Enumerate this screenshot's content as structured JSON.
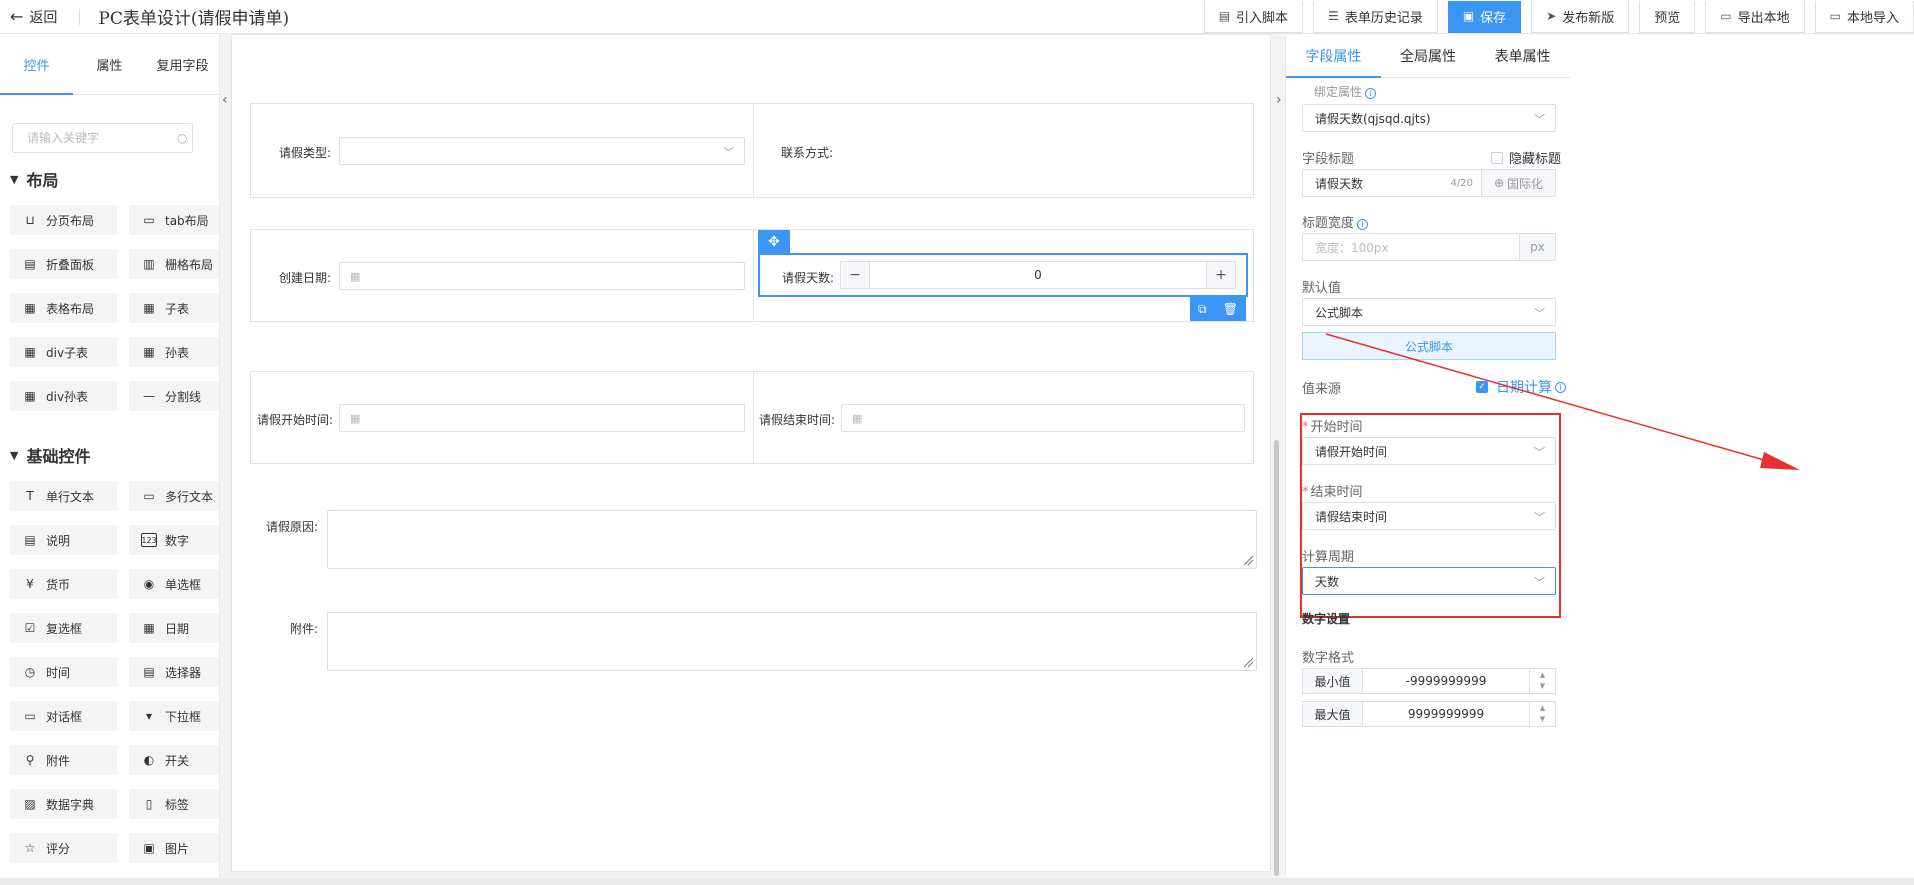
{
  "header": {
    "back_label": "返回",
    "title": "PC表单设计(请假申请单)",
    "buttons": {
      "import_script": "引入脚本",
      "history": "表单历史记录",
      "save": "保存",
      "publish": "发布新版",
      "preview": "预览",
      "export_local": "导出本地",
      "import_local": "本地导入"
    }
  },
  "left_panel": {
    "tabs": [
      "控件",
      "属性",
      "复用字段"
    ],
    "search_placeholder": "请输入关键字",
    "layout_group": {
      "title": "布局",
      "items": [
        "分页布局",
        "tab布局",
        "折叠面板",
        "栅格布局",
        "表格布局",
        "子表",
        "div子表",
        "孙表",
        "div孙表",
        "分割线"
      ]
    },
    "basic_group": {
      "title": "基础控件",
      "items": [
        "单行文本",
        "多行文本",
        "说明",
        "数字",
        "货币",
        "单选框",
        "复选框",
        "日期",
        "时间",
        "选择器",
        "对话框",
        "下拉框",
        "附件",
        "开关",
        "数据字典",
        "标签",
        "评分",
        "图片"
      ]
    }
  },
  "canvas": {
    "leave_type_label": "请假类型:",
    "contact_label": "联系方式:",
    "create_date_label": "创建日期:",
    "leave_days_label": "请假天数:",
    "leave_days_value": "0",
    "start_time_label": "请假开始时间:",
    "end_time_label": "请假结束时间:",
    "reason_label": "请假原因:",
    "attachment_label": "附件:"
  },
  "right_panel": {
    "tabs": [
      "字段属性",
      "全局属性",
      "表单属性"
    ],
    "bind_attr_label": "绑定属性",
    "bind_attr_value": "请假天数(qjsqd.qjts)",
    "field_title_label": "字段标题",
    "hide_title_label": "隐藏标题",
    "field_title_value": "请假天数",
    "field_title_count": "4/20",
    "i18n_label": "国际化",
    "title_width_label": "标题宽度",
    "title_width_placeholder": "宽度：100px",
    "title_width_unit": "px",
    "default_value_label": "默认值",
    "default_value_select": "公式脚本",
    "formula_button": "公式脚本",
    "value_source_label": "值来源",
    "date_calc_label": "日期计算",
    "start_time_label": "开始时间",
    "start_time_value": "请假开始时间",
    "end_time_label": "结束时间",
    "end_time_value": "请假结束时间",
    "period_label": "计算周期",
    "period_value": "天数",
    "number_settings_label": "数字设置",
    "number_format_label": "数字格式",
    "min_label": "最小值",
    "min_value": "-9999999999",
    "max_label": "最大值",
    "max_value": "9999999999"
  },
  "colors": {
    "accent": "#3a95f5",
    "highlight_red": "#e8312c"
  }
}
